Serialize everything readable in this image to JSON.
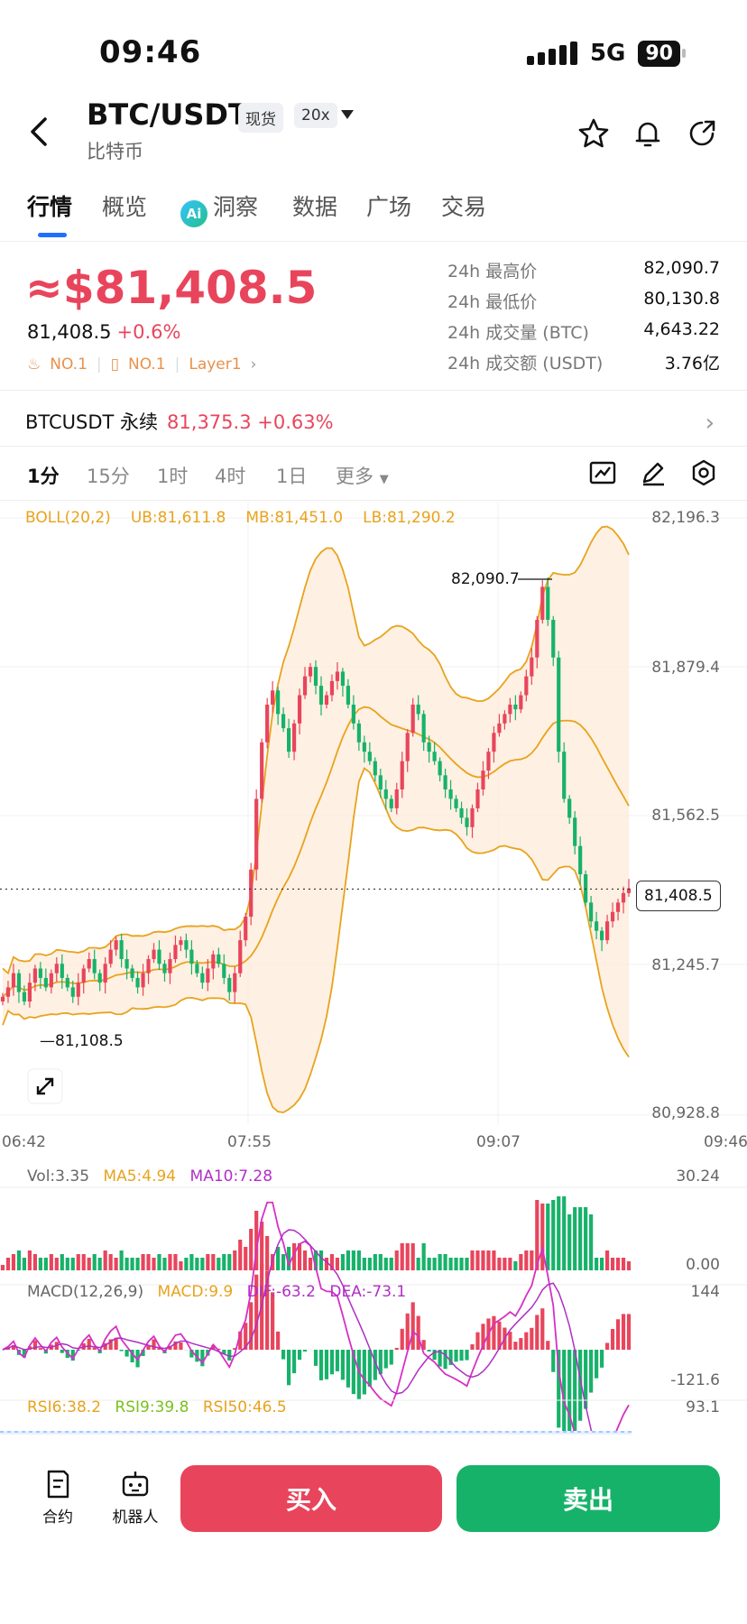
{
  "status": {
    "time": "09:46",
    "network": "5G",
    "battery": "90"
  },
  "header": {
    "pair": "BTC/USDT",
    "tag_spot": "现货",
    "tag_leverage": "20x",
    "name": "比特币"
  },
  "tabs": [
    "行情",
    "概览",
    "洞察",
    "数据",
    "广场",
    "交易"
  ],
  "price": {
    "main": "≈$81,408.5",
    "last": "81,408.5",
    "change": "+0.6%",
    "rank1": "NO.1",
    "rank2": "NO.1",
    "layer": "Layer1"
  },
  "stats": [
    {
      "label": "24h 最高价",
      "value": "82,090.7"
    },
    {
      "label": "24h 最低价",
      "value": "80,130.8"
    },
    {
      "label": "24h 成交量 (BTC)",
      "value": "4,643.22"
    },
    {
      "label": "24h 成交额 (USDT)",
      "value": "3.76亿"
    }
  ],
  "perp": {
    "label": "BTCUSDT 永续",
    "price": "81,375.3",
    "change": "+0.63%"
  },
  "timeframes": [
    "1分",
    "15分",
    "1时",
    "4时",
    "1日",
    "更多"
  ],
  "boll": {
    "label": "BOLL(20,2)",
    "ub": "UB:81,611.8",
    "mb": "MB:81,451.0",
    "lb": "LB:81,290.2"
  },
  "y_labels": [
    "82,196.3",
    "81,879.4",
    "81,562.5",
    "81,245.7",
    "80,928.8"
  ],
  "x_labels": [
    "06:42",
    "07:55",
    "09:07",
    "09:46"
  ],
  "annot": {
    "high": "82,090.7",
    "low": "81,108.5",
    "current": "81,408.5"
  },
  "vol": {
    "vol": "Vol:3.35",
    "ma5": "MA5:4.94",
    "ma10": "MA10:7.28",
    "max": "30.24",
    "min": "0.00"
  },
  "macd": {
    "label": "MACD(12,26,9)",
    "macd": "MACD:9.9",
    "dif": "DIF:-63.2",
    "dea": "DEA:-73.1",
    "max": "144",
    "min": "-121.6"
  },
  "rsi": {
    "rsi6": "RSI6:38.2",
    "rsi9": "RSI9:39.8",
    "rsi50": "RSI50:46.5",
    "max": "93.1"
  },
  "bottom": {
    "contract": "合约",
    "robot": "机器人",
    "buy": "买入",
    "sell": "卖出"
  },
  "colors": {
    "up": "#e8455c",
    "down": "#17b26a",
    "accent": "#1f6fff",
    "boll": "#e8a31d"
  },
  "chart_data": {
    "type": "candlestick",
    "title": "",
    "x_ticks": [
      "06:42",
      "07:55",
      "09:07",
      "09:46"
    ],
    "ylim": [
      80928.8,
      82196.3
    ],
    "y_ticks": [
      82196.3,
      81879.4,
      81562.5,
      81245.7,
      80928.8
    ],
    "close_series": [
      81180,
      81200,
      81230,
      81190,
      81170,
      81210,
      81240,
      81220,
      81200,
      81230,
      81250,
      81220,
      81200,
      81180,
      81210,
      81240,
      81260,
      81230,
      81210,
      81250,
      81280,
      81300,
      81260,
      81240,
      81220,
      81200,
      81230,
      81260,
      81280,
      81250,
      81230,
      81260,
      81290,
      81300,
      81280,
      81250,
      81230,
      81210,
      81240,
      81270,
      81250,
      81220,
      81190,
      81230,
      81300,
      81350,
      81450,
      81600,
      81720,
      81800,
      81830,
      81780,
      81750,
      81700,
      81760,
      81820,
      81860,
      81880,
      81840,
      81800,
      81820,
      81850,
      81870,
      81840,
      81800,
      81760,
      81720,
      81700,
      81680,
      81650,
      81620,
      81600,
      81580,
      81620,
      81680,
      81740,
      81800,
      81780,
      81720,
      81700,
      81680,
      81650,
      81620,
      81600,
      81580,
      81560,
      81540,
      81580,
      81620,
      81660,
      81700,
      81740,
      81760,
      81780,
      81800,
      81790,
      81820,
      81860,
      81900,
      81980,
      82050,
      81980,
      81900,
      81700,
      81600,
      81560,
      81500,
      81440,
      81380,
      81340,
      81320,
      81300,
      81340,
      81360,
      81380,
      81400,
      81410
    ],
    "high": 82090.7,
    "low": 81108.5,
    "current": 81408.5
  }
}
